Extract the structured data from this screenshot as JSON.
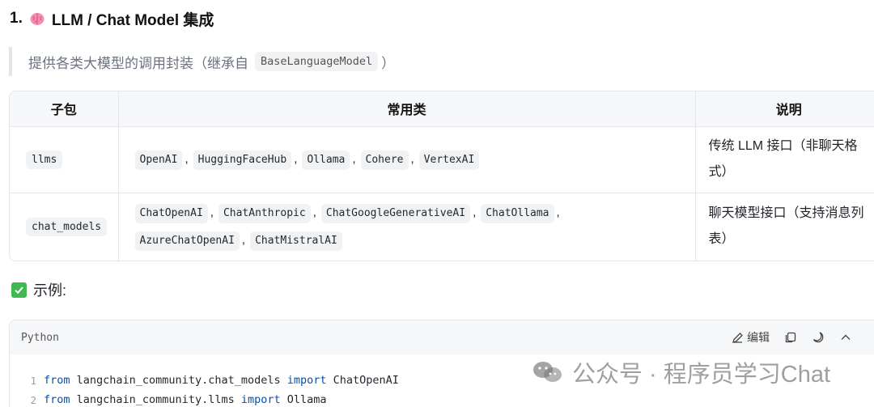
{
  "heading": {
    "number": "1.",
    "title": "LLM / Chat Model 集成",
    "icon": "brain-icon"
  },
  "quote": {
    "prefix": "提供各类大模型的调用封装（继承自",
    "code": "BaseLanguageModel",
    "suffix": "）"
  },
  "table": {
    "headers": [
      "子包",
      "常用类",
      "说明"
    ],
    "rows": [
      {
        "package": "llms",
        "classes": [
          "OpenAI",
          "HuggingFaceHub",
          "Ollama",
          "Cohere",
          "VertexAI"
        ],
        "description": "传统 LLM 接口（非聊天格式）"
      },
      {
        "package": "chat_models",
        "classes": [
          "ChatOpenAI",
          "ChatAnthropic",
          "ChatGoogleGenerativeAI",
          "ChatOllama",
          "AzureChatOpenAI",
          "ChatMistralAI"
        ],
        "description": "聊天模型接口（支持消息列表）"
      }
    ]
  },
  "separator": ",",
  "example": {
    "label": "示例:",
    "icon": "check-icon"
  },
  "code_block": {
    "language": "Python",
    "edit_label": "编辑",
    "lines": [
      {
        "number": "1",
        "kw1": "from",
        "module": " langchain_community.chat_models ",
        "kw2": "import",
        "name": " ChatOpenAI"
      },
      {
        "number": "2",
        "kw1": "from",
        "module": " langchain_community.llms ",
        "kw2": "import",
        "name": " Ollama"
      }
    ]
  },
  "watermark": {
    "text": "公众号 · 程序员学习Chat",
    "icon": "wechat-icon"
  },
  "colors": {
    "keyword": "#0550ae",
    "check": "#3fb950",
    "border": "#e4e6ea"
  }
}
